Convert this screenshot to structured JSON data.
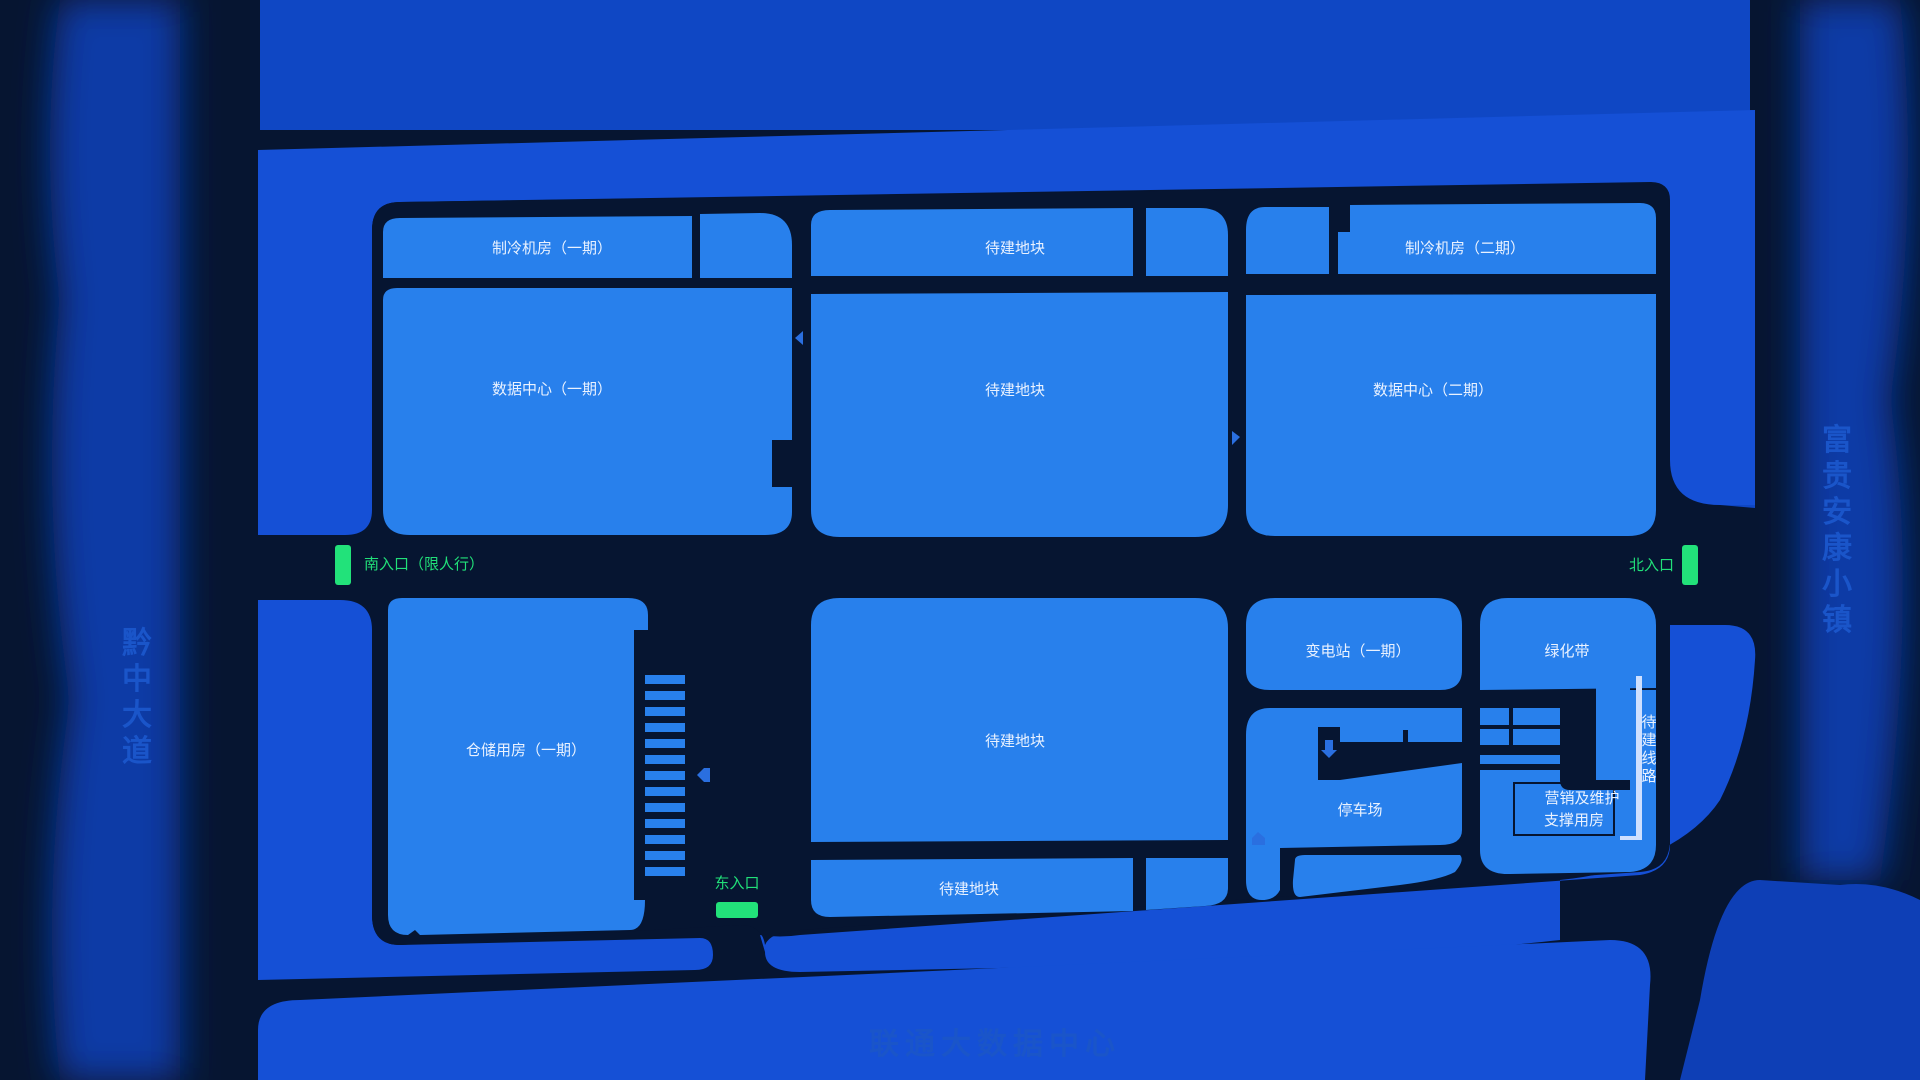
{
  "map": {
    "colors": {
      "background": "#061531",
      "outer_land": "#0b3aa8",
      "outer_land_light": "#1550d6",
      "road": "#061531",
      "plot": "#2880ec",
      "gate": "#22e27a",
      "gate_label": "#21e079",
      "area_label": "#1a55c9"
    },
    "areas": {
      "west": "黔中大道",
      "east": "富贵安康小镇",
      "south": "联通大数据中心"
    },
    "plots": {
      "cooling_1": "制冷机房（一期）",
      "reserved_a": "待建地块",
      "cooling_2": "制冷机房（二期）",
      "datacenter_1": "数据中心（一期）",
      "reserved_b": "待建地块",
      "datacenter_2": "数据中心（二期）",
      "storage_1": "仓储用房（一期）",
      "reserved_c": "待建地块",
      "substation_1": "变电站（一期）",
      "greenbelt": "绿化带",
      "parking": "停车场",
      "reserved_d": "待建地块",
      "sales_line1": "营销及维护",
      "sales_line2": "支撑用房",
      "route_label": [
        "待",
        "建",
        "线",
        "路"
      ]
    },
    "gates": {
      "south": "南入口（限人行）",
      "north": "北入口",
      "east": "东入口"
    }
  }
}
